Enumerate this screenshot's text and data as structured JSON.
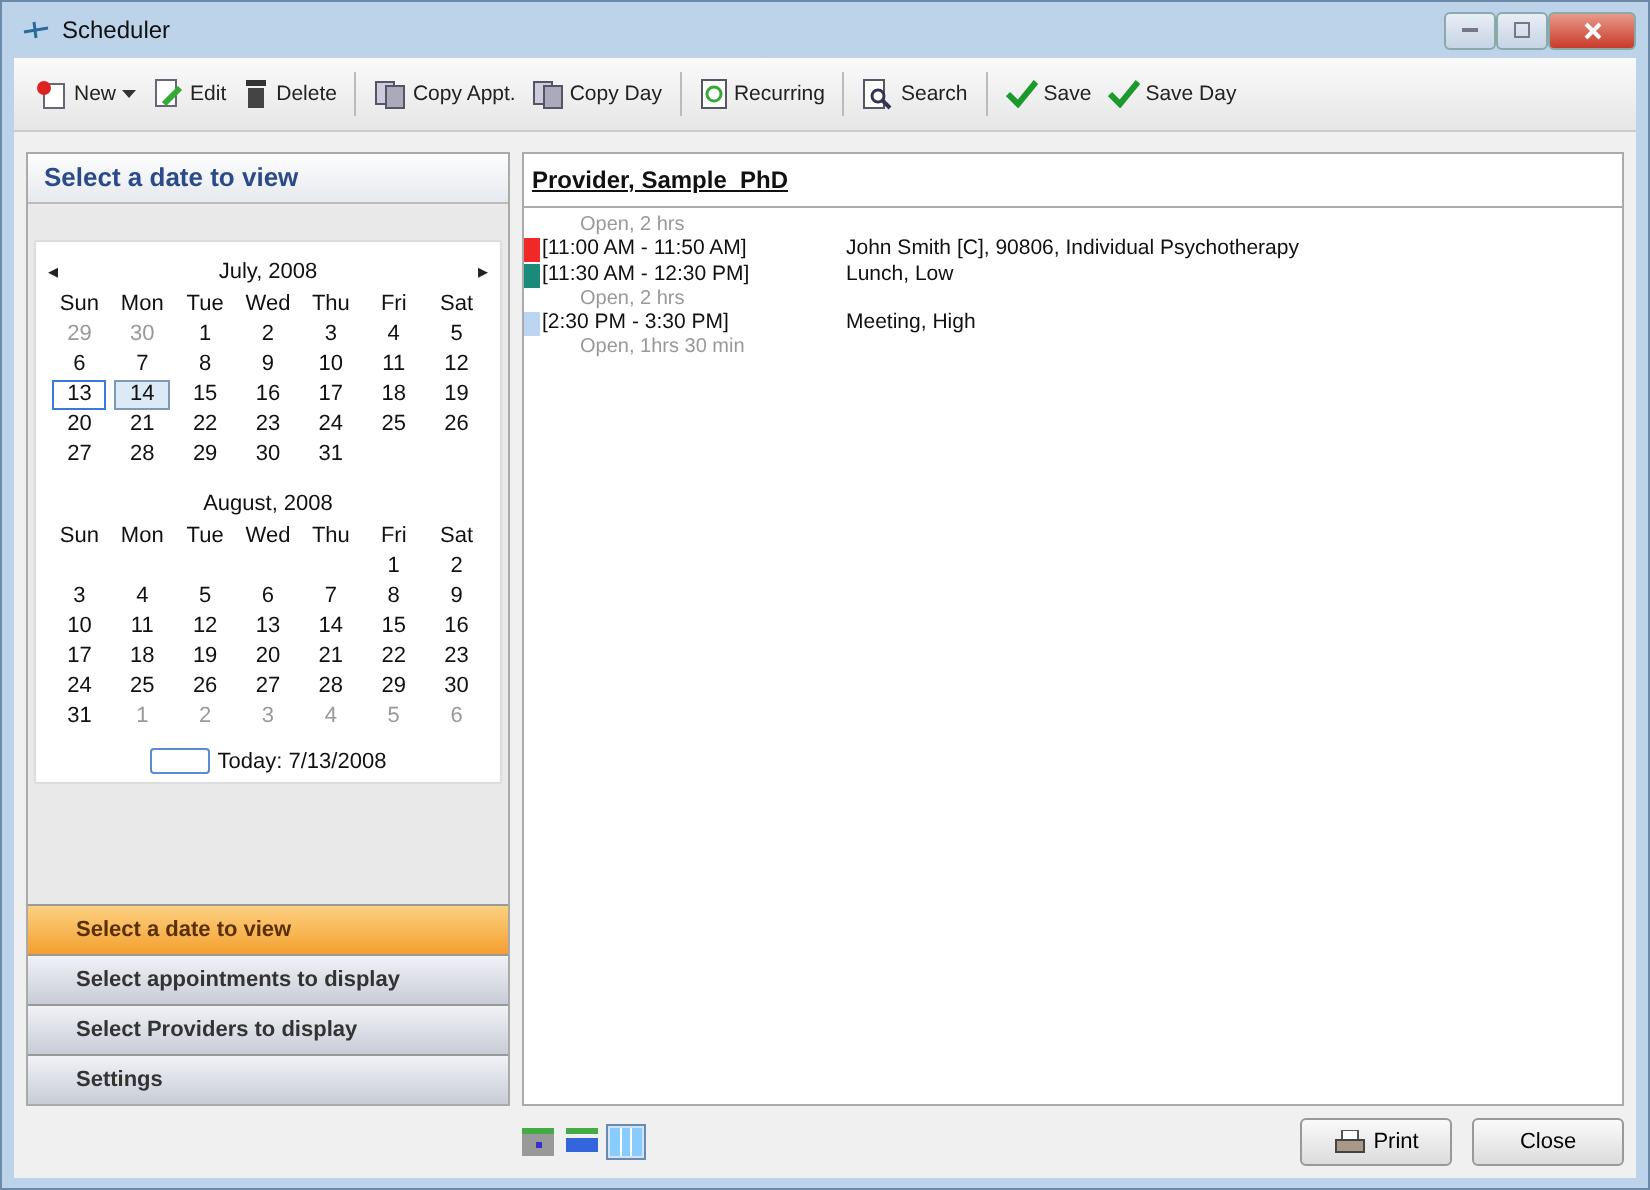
{
  "window": {
    "title": "Scheduler"
  },
  "toolbar": {
    "groups": [
      [
        {
          "kind": "new",
          "label": "New",
          "dropdown": true
        },
        {
          "kind": "edit",
          "label": "Edit",
          "dropdown": false
        },
        {
          "kind": "delete",
          "label": "Delete",
          "dropdown": false
        }
      ],
      [
        {
          "kind": "copy",
          "label": "Copy Appt.",
          "dropdown": false
        },
        {
          "kind": "copy",
          "label": "Copy Day",
          "dropdown": false
        }
      ],
      [
        {
          "kind": "recurring",
          "label": "Recurring",
          "dropdown": false
        }
      ],
      [
        {
          "kind": "search",
          "label": "Search",
          "dropdown": false
        }
      ],
      [
        {
          "kind": "save",
          "label": "Save",
          "dropdown": false
        },
        {
          "kind": "save",
          "label": "Save Day",
          "dropdown": false
        }
      ]
    ]
  },
  "left_panel": {
    "title": "Select a date to view",
    "calendars": [
      {
        "month": "July, 2008",
        "prev_arrow": "◂",
        "next_arrow": "▸",
        "weekdays": [
          "Sun",
          "Mon",
          "Tue",
          "Wed",
          "Thu",
          "Fri",
          "Sat"
        ],
        "weeks": [
          [
            {
              "text": "29",
              "other_month": true,
              "selected": false,
              "today": false
            },
            {
              "text": "30",
              "other_month": true,
              "selected": false,
              "today": false
            },
            {
              "text": "1",
              "other_month": false,
              "selected": false,
              "today": false
            },
            {
              "text": "2",
              "other_month": false,
              "selected": false,
              "today": false
            },
            {
              "text": "3",
              "other_month": false,
              "selected": false,
              "today": false
            },
            {
              "text": "4",
              "other_month": false,
              "selected": false,
              "today": false
            },
            {
              "text": "5",
              "other_month": false,
              "selected": false,
              "today": false
            }
          ],
          [
            {
              "text": "6",
              "other_month": false,
              "selected": false,
              "today": false
            },
            {
              "text": "7",
              "other_month": false,
              "selected": false,
              "today": false
            },
            {
              "text": "8",
              "other_month": false,
              "selected": false,
              "today": false
            },
            {
              "text": "9",
              "other_month": false,
              "selected": false,
              "today": false
            },
            {
              "text": "10",
              "other_month": false,
              "selected": false,
              "today": false
            },
            {
              "text": "11",
              "other_month": false,
              "selected": false,
              "today": false
            },
            {
              "text": "12",
              "other_month": false,
              "selected": false,
              "today": false
            }
          ],
          [
            {
              "text": "13",
              "other_month": false,
              "selected": false,
              "today": true
            },
            {
              "text": "14",
              "other_month": false,
              "selected": true,
              "today": false
            },
            {
              "text": "15",
              "other_month": false,
              "selected": false,
              "today": false
            },
            {
              "text": "16",
              "other_month": false,
              "selected": false,
              "today": false
            },
            {
              "text": "17",
              "other_month": false,
              "selected": false,
              "today": false
            },
            {
              "text": "18",
              "other_month": false,
              "selected": false,
              "today": false
            },
            {
              "text": "19",
              "other_month": false,
              "selected": false,
              "today": false
            }
          ],
          [
            {
              "text": "20",
              "other_month": false,
              "selected": false,
              "today": false
            },
            {
              "text": "21",
              "other_month": false,
              "selected": false,
              "today": false
            },
            {
              "text": "22",
              "other_month": false,
              "selected": false,
              "today": false
            },
            {
              "text": "23",
              "other_month": false,
              "selected": false,
              "today": false
            },
            {
              "text": "24",
              "other_month": false,
              "selected": false,
              "today": false
            },
            {
              "text": "25",
              "other_month": false,
              "selected": false,
              "today": false
            },
            {
              "text": "26",
              "other_month": false,
              "selected": false,
              "today": false
            }
          ],
          [
            {
              "text": "27",
              "other_month": false,
              "selected": false,
              "today": false
            },
            {
              "text": "28",
              "other_month": false,
              "selected": false,
              "today": false
            },
            {
              "text": "29",
              "other_month": false,
              "selected": false,
              "today": false
            },
            {
              "text": "30",
              "other_month": false,
              "selected": false,
              "today": false
            },
            {
              "text": "31",
              "other_month": false,
              "selected": false,
              "today": false
            }
          ]
        ]
      },
      {
        "month": "August, 2008",
        "weekdays": [
          "Sun",
          "Mon",
          "Tue",
          "Wed",
          "Thu",
          "Fri",
          "Sat"
        ],
        "weeks": [
          [
            {
              "text": "1",
              "other_month": false,
              "selected": false,
              "today": false
            },
            {
              "text": "2",
              "other_month": false,
              "selected": false,
              "today": false
            }
          ],
          [
            {
              "text": "3",
              "other_month": false,
              "selected": false,
              "today": false
            },
            {
              "text": "4",
              "other_month": false,
              "selected": false,
              "today": false
            },
            {
              "text": "5",
              "other_month": false,
              "selected": false,
              "today": false
            },
            {
              "text": "6",
              "other_month": false,
              "selected": false,
              "today": false
            },
            {
              "text": "7",
              "other_month": false,
              "selected": false,
              "today": false
            },
            {
              "text": "8",
              "other_month": false,
              "selected": false,
              "today": false
            },
            {
              "text": "9",
              "other_month": false,
              "selected": false,
              "today": false
            }
          ],
          [
            {
              "text": "10",
              "other_month": false,
              "selected": false,
              "today": false
            },
            {
              "text": "11",
              "other_month": false,
              "selected": false,
              "today": false
            },
            {
              "text": "12",
              "other_month": false,
              "selected": false,
              "today": false
            },
            {
              "text": "13",
              "other_month": false,
              "selected": false,
              "today": false
            },
            {
              "text": "14",
              "other_month": false,
              "selected": false,
              "today": false
            },
            {
              "text": "15",
              "other_month": false,
              "selected": false,
              "today": false
            },
            {
              "text": "16",
              "other_month": false,
              "selected": false,
              "today": false
            }
          ],
          [
            {
              "text": "17",
              "other_month": false,
              "selected": false,
              "today": false
            },
            {
              "text": "18",
              "other_month": false,
              "selected": false,
              "today": false
            },
            {
              "text": "19",
              "other_month": false,
              "selected": false,
              "today": false
            },
            {
              "text": "20",
              "other_month": false,
              "selected": false,
              "today": false
            },
            {
              "text": "21",
              "other_month": false,
              "selected": false,
              "today": false
            },
            {
              "text": "22",
              "other_month": false,
              "selected": false,
              "today": false
            },
            {
              "text": "23",
              "other_month": false,
              "selected": false,
              "today": false
            }
          ],
          [
            {
              "text": "24",
              "other_month": false,
              "selected": false,
              "today": false
            },
            {
              "text": "25",
              "other_month": false,
              "selected": false,
              "today": false
            },
            {
              "text": "26",
              "other_month": false,
              "selected": false,
              "today": false
            },
            {
              "text": "27",
              "other_month": false,
              "selected": false,
              "today": false
            },
            {
              "text": "28",
              "other_month": false,
              "selected": false,
              "today": false
            },
            {
              "text": "29",
              "other_month": false,
              "selected": false,
              "today": false
            },
            {
              "text": "30",
              "other_month": false,
              "selected": false,
              "today": false
            }
          ],
          [
            {
              "text": "31",
              "other_month": false,
              "selected": false,
              "today": false
            },
            {
              "text": "1",
              "other_month": true,
              "selected": false,
              "today": false
            },
            {
              "text": "2",
              "other_month": true,
              "selected": false,
              "today": false
            },
            {
              "text": "3",
              "other_month": true,
              "selected": false,
              "today": false
            },
            {
              "text": "4",
              "other_month": true,
              "selected": false,
              "today": false
            },
            {
              "text": "5",
              "other_month": true,
              "selected": false,
              "today": false
            },
            {
              "text": "6",
              "other_month": true,
              "selected": false,
              "today": false
            }
          ]
        ]
      }
    ],
    "today_label": "Today: 7/13/2008",
    "nav_items": [
      {
        "label": "Select a date to view",
        "selected": true
      },
      {
        "label": "Select appointments to display",
        "selected": false
      },
      {
        "label": "Select Providers to display",
        "selected": false
      },
      {
        "label": "Settings",
        "selected": false
      }
    ]
  },
  "schedule": {
    "provider": "Provider, Sample  PhD",
    "entries": [
      {
        "kind": "open",
        "text": "Open, 2 hrs"
      },
      {
        "kind": "appointment",
        "time": "[11:00 AM - 11:50 AM]",
        "text": "John Smith [C], 90806, Individual Psychotherapy",
        "color": "#f02828"
      },
      {
        "kind": "appointment",
        "time": "[11:30 AM - 12:30 PM]",
        "text": "Lunch, Low",
        "color": "#1a8a7a"
      },
      {
        "kind": "open",
        "text": "Open, 2 hrs"
      },
      {
        "kind": "appointment",
        "time": "[2:30 PM - 3:30 PM]",
        "text": "Meeting, High",
        "color": "#bcd6f2"
      },
      {
        "kind": "open",
        "text": "Open, 1hrs 30 min"
      }
    ]
  },
  "footer": {
    "views": [
      {
        "kind": "day",
        "selected": false
      },
      {
        "kind": "week",
        "selected": false
      },
      {
        "kind": "columns",
        "selected": true
      }
    ],
    "buttons": [
      {
        "kind": "print",
        "label": "Print"
      },
      {
        "kind": "close",
        "label": "Close"
      }
    ]
  }
}
